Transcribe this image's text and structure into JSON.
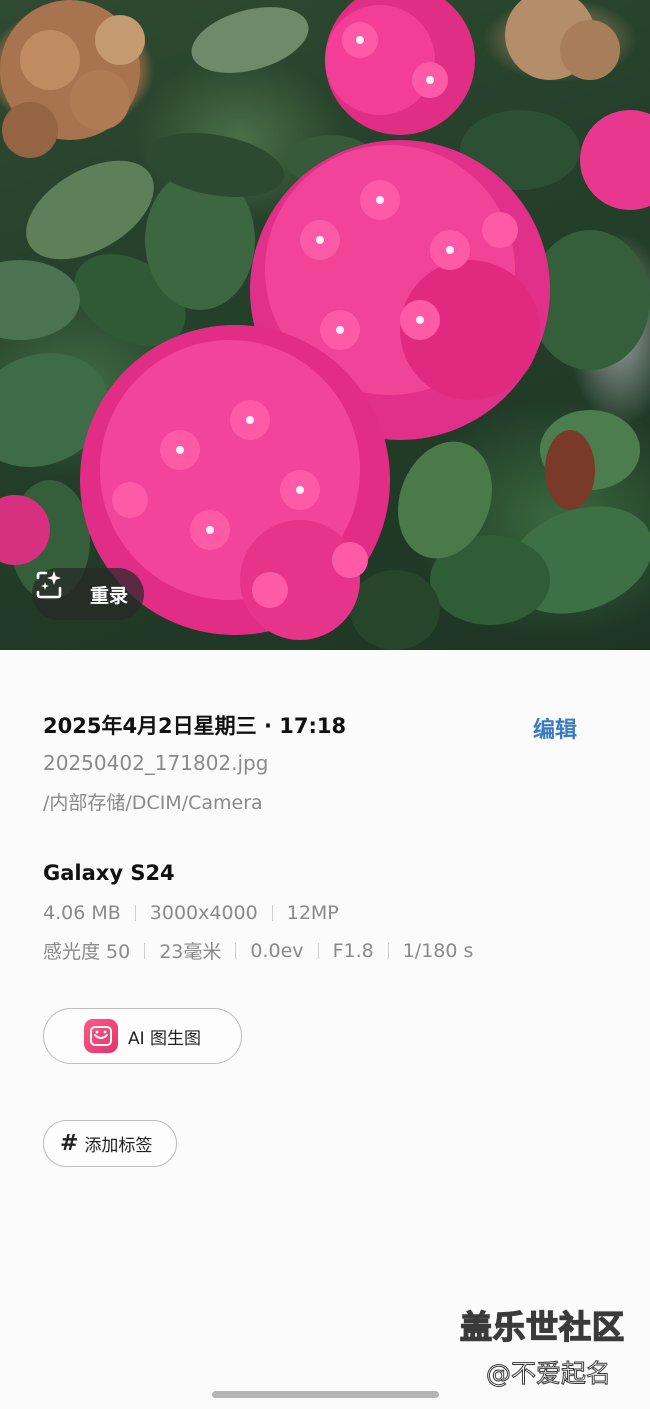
{
  "photo": {
    "recapture_label": "重录",
    "recapture_icon": "sparkle-frame-icon"
  },
  "details": {
    "datetime": "2025年4月2日星期三 · 17:18",
    "edit_label": "编辑",
    "filename": "20250402_171802.jpg",
    "path": "/内部存储/DCIM/Camera",
    "device": "Galaxy S24",
    "file_info": [
      "4.06 MB",
      "3000x4000",
      "12MP"
    ],
    "camera_info": [
      "感光度 50",
      "23毫米",
      "0.0ev",
      "F1.8",
      "1/180 s"
    ]
  },
  "ai_button": {
    "label": "AI 图生图",
    "icon": "ai-image-app-icon"
  },
  "tag_button": {
    "icon": "#",
    "label": "添加标签"
  },
  "watermark": {
    "title": "盖乐世社区",
    "user": "@不爱起名"
  },
  "colors": {
    "accent": "#3b7bbf",
    "flower_pink": "#ee2f8e",
    "background": "#fbfbfb"
  }
}
